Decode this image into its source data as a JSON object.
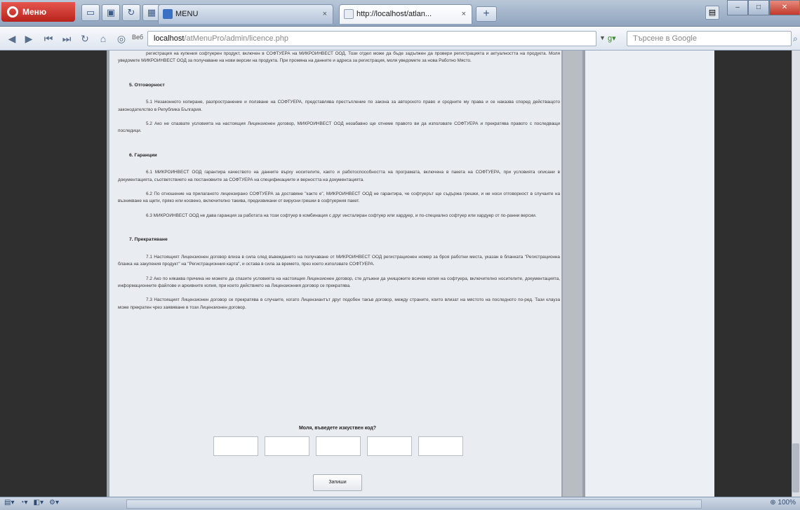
{
  "browser": {
    "menu_label": "Меню",
    "tabs": [
      {
        "label": "MENU",
        "active": false
      },
      {
        "label": "http://localhost/atlan...",
        "active": true
      }
    ],
    "new_tab_symbol": "+",
    "url": {
      "badge": "Веб",
      "host": "localhost",
      "path": "/atMenuPro/admin/licence.php"
    },
    "search_placeholder": "Търсене в Google",
    "zoom": "100%"
  },
  "document": {
    "top_paragraph": "регистрация на купения софтуерен продукт, включен в СОФТУЕРА на МИКРОИНВЕСТ ООД. Този отдел може да бъде задължен да провери регистрацията и актуалността на продукта. Моля уведомете МИКРОИНВЕСТ ООД за получаване на нови версии на продукта. При промяна на данните и адреса за регистрация, моля уведомете за нова Работно Място.",
    "sections": [
      {
        "heading": "5. Отговорност",
        "paragraphs": [
          "5.1 Незаконното копиране, разпространение и ползване на СОФТУЕРА, представлява престъпление по закона за авторското право и сродните му права и се наказва според действащото законодателство в Република България.",
          "5.2 Ако не спазвате условията на настоящия Лицензионен договор, МИКРОИНВЕСТ ООД незабавно ще отнеме правото ви да използвате СОФТУЕРА и прекратява правото с последващи последици."
        ]
      },
      {
        "heading": "6. Гаранции",
        "paragraphs": [
          "6.1 МИКРОИНВЕСТ ООД гарантира качеството на данните върху носителите, както и работоспособността на програмата, включена в пакета на СОФТУЕРА, при условията описани в документацията, съответствието на постановките за СОФТУЕРА на спецификациите и верността на документацията.",
          "6.2 По отношение на прилаганото лицензирано СОФТУЕРА за доставяне \"както е\", МИКРОИНВЕСТ ООД не гарантира, че софтуерът ще съдържа грешки, и не носи отговорност в случаите на възникване на щети, пряко или косвено, включително такива, предизвикани от вирусни грешки в софтуерния пакет.",
          "6.3 МИКРОИНВЕСТ ООД не дава гаранция за работата на този софтуер в комбинация с друг инсталиран софтуер или хардуер, и по-специално софтуер или хардуер от по-ранни версии."
        ]
      },
      {
        "heading": "7. Прекратяване",
        "paragraphs": [
          "7.1 Настоящият Лицензионен договор влиза в сила след въвеждането на получаване от МИКРОИНВЕСТ ООД регистрационен номер за броя работни места, указан в бланката \"Регистрационна бланка на закупения продукт\" на \"Регистрационния карта\", и остава в сила за времето, през което използвате СОФТУЕРА.",
          "7.2 Ако по някаква причина не можете да спазите условията на настоящия Лицензионен договор, сте длъжни да унищожите всички копия на софтуера, включително носителите, документацията, информационните файлове и архивните копия, при което действието на Лицензионния договор се прекратява.",
          "7.3 Настоящият Лицензионен договор се прекратява в случаите, когато Лицензиантът друг подобен такъв договор, между страните, които влизат на мястото на последното по-ред. Тази клауза може прекратен чрез заявяване в този Лицензионен договор."
        ]
      }
    ],
    "captcha_question": "Моля, въведете изкуствен код?",
    "captcha_boxes": [
      "",
      "",
      "",
      "",
      ""
    ],
    "submit_label": "Запиши"
  }
}
